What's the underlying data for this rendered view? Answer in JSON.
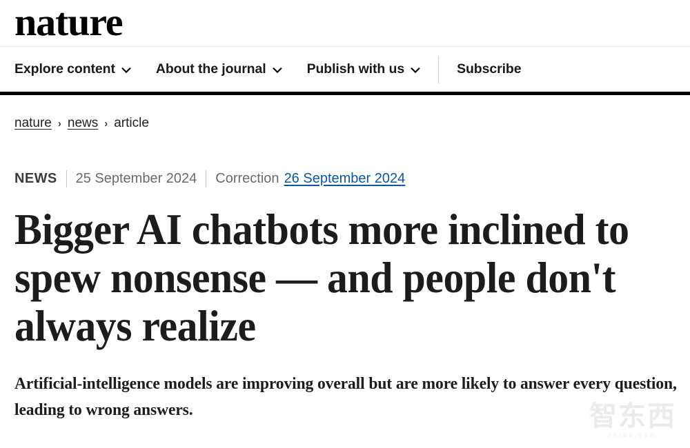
{
  "site": {
    "logo_text": "nature"
  },
  "nav": {
    "items": [
      {
        "label": "Explore content",
        "has_dropdown": true
      },
      {
        "label": "About the journal",
        "has_dropdown": true
      },
      {
        "label": "Publish with us",
        "has_dropdown": true
      },
      {
        "label": "Subscribe",
        "has_dropdown": false
      }
    ],
    "chevron_icon": "chevron-down-icon"
  },
  "breadcrumb": {
    "items": [
      {
        "label": "nature",
        "is_link": true
      },
      {
        "label": "news",
        "is_link": true
      },
      {
        "label": "article",
        "is_link": false
      }
    ],
    "separator": "›"
  },
  "meta": {
    "type": "NEWS",
    "published_date": "25 September 2024",
    "correction_label": "Correction",
    "correction_date": "26 September 2024"
  },
  "article": {
    "headline": "Bigger AI chatbots more inclined to spew nonsense — and people don't always realize",
    "standfirst": "Artificial-intelligence models are improving overall but are more likely to answer every question, leading to wrong answers."
  },
  "watermark": {
    "chars": "智东西",
    "url": "zhidx.com"
  },
  "colors": {
    "link_blue": "#0b57a4",
    "text_dark": "#1c1c1c",
    "meta_gray": "#6a6a6a",
    "rule_black": "#000000"
  }
}
